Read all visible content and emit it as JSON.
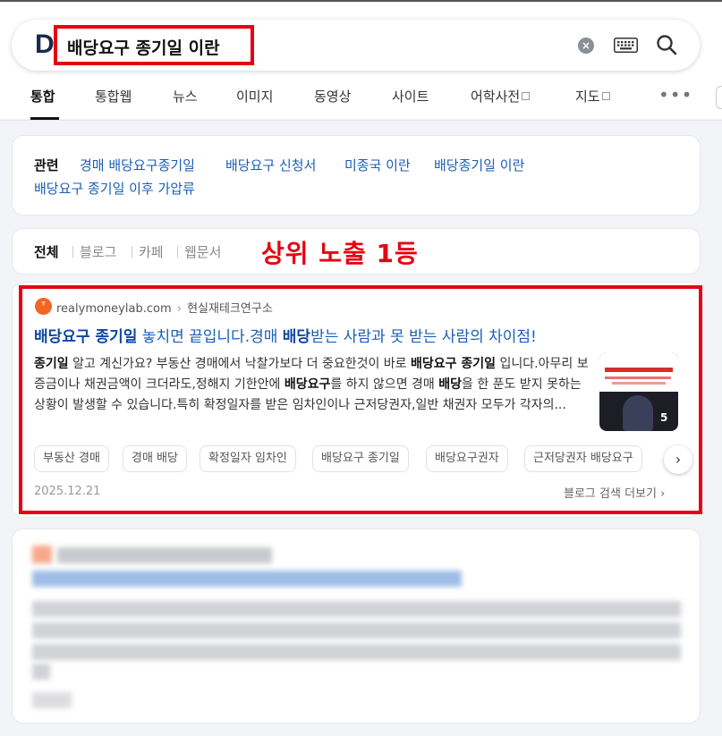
{
  "search": {
    "logo": "D",
    "query": "배당요구 종기일 이란",
    "clear_label": "×"
  },
  "tabs": [
    {
      "label": "통합",
      "active": true
    },
    {
      "label": "통합웹"
    },
    {
      "label": "뉴스"
    },
    {
      "label": "이미지"
    },
    {
      "label": "동영상"
    },
    {
      "label": "사이트"
    },
    {
      "label": "어학사전"
    },
    {
      "label": "지도"
    }
  ],
  "more_label": "•••",
  "related": {
    "title": "관련",
    "links": [
      "경매 배당요구종기일",
      "배당요구 신청서",
      "미종국 이란",
      "배당종기일 이란",
      "배당요구 종기일 이후 가압류"
    ]
  },
  "filters": [
    "전체",
    "블로그",
    "카페",
    "웹문서"
  ],
  "annotation": "상위 노출 1등",
  "result": {
    "favicon": "ᵀ",
    "domain": "realymoneylab.com",
    "breadcrumb_sep": "›",
    "site_name": "현실재테크연구소",
    "title_bold1": "배당요구 종기일",
    "title_mid": " 놓치면 끝입니다.경매 ",
    "title_bold2": "배당",
    "title_end": "받는 사람과 못 받는 사람의 차이점!",
    "desc": [
      {
        "t": "종기일",
        "b": true
      },
      {
        "t": " 알고 계신가요? 부동산 경매에서 낙찰가보다 더 중요한것이 바로 "
      },
      {
        "t": "배당요구 종기일",
        "b": true
      },
      {
        "t": " 입니다.아무리 보증금이나 채권금액이 크더라도,정해지 기한안에 "
      },
      {
        "t": "배당요구",
        "b": true
      },
      {
        "t": "를 하지 않으면 경매 "
      },
      {
        "t": "배당",
        "b": true
      },
      {
        "t": "을 한 푼도 받지 못하는 상황이 발생할 수 있습니다.특히 확정일자를 받은 임차인이나 근저당권자,일반 채권자 모두가 각자의..."
      }
    ],
    "thumb_count": "5",
    "chips": [
      "부동산 경매",
      "경매 배당",
      "확정일자 임차인",
      "배당요구 종기일",
      "배당요구권자",
      "근저당권자 배당요구"
    ],
    "chip_next": "›",
    "date": "2025.12.21",
    "more": "블로그 검색 더보기 ›"
  },
  "colors": {
    "accent_red": "#e60012",
    "link_blue": "#1a5fb4"
  }
}
